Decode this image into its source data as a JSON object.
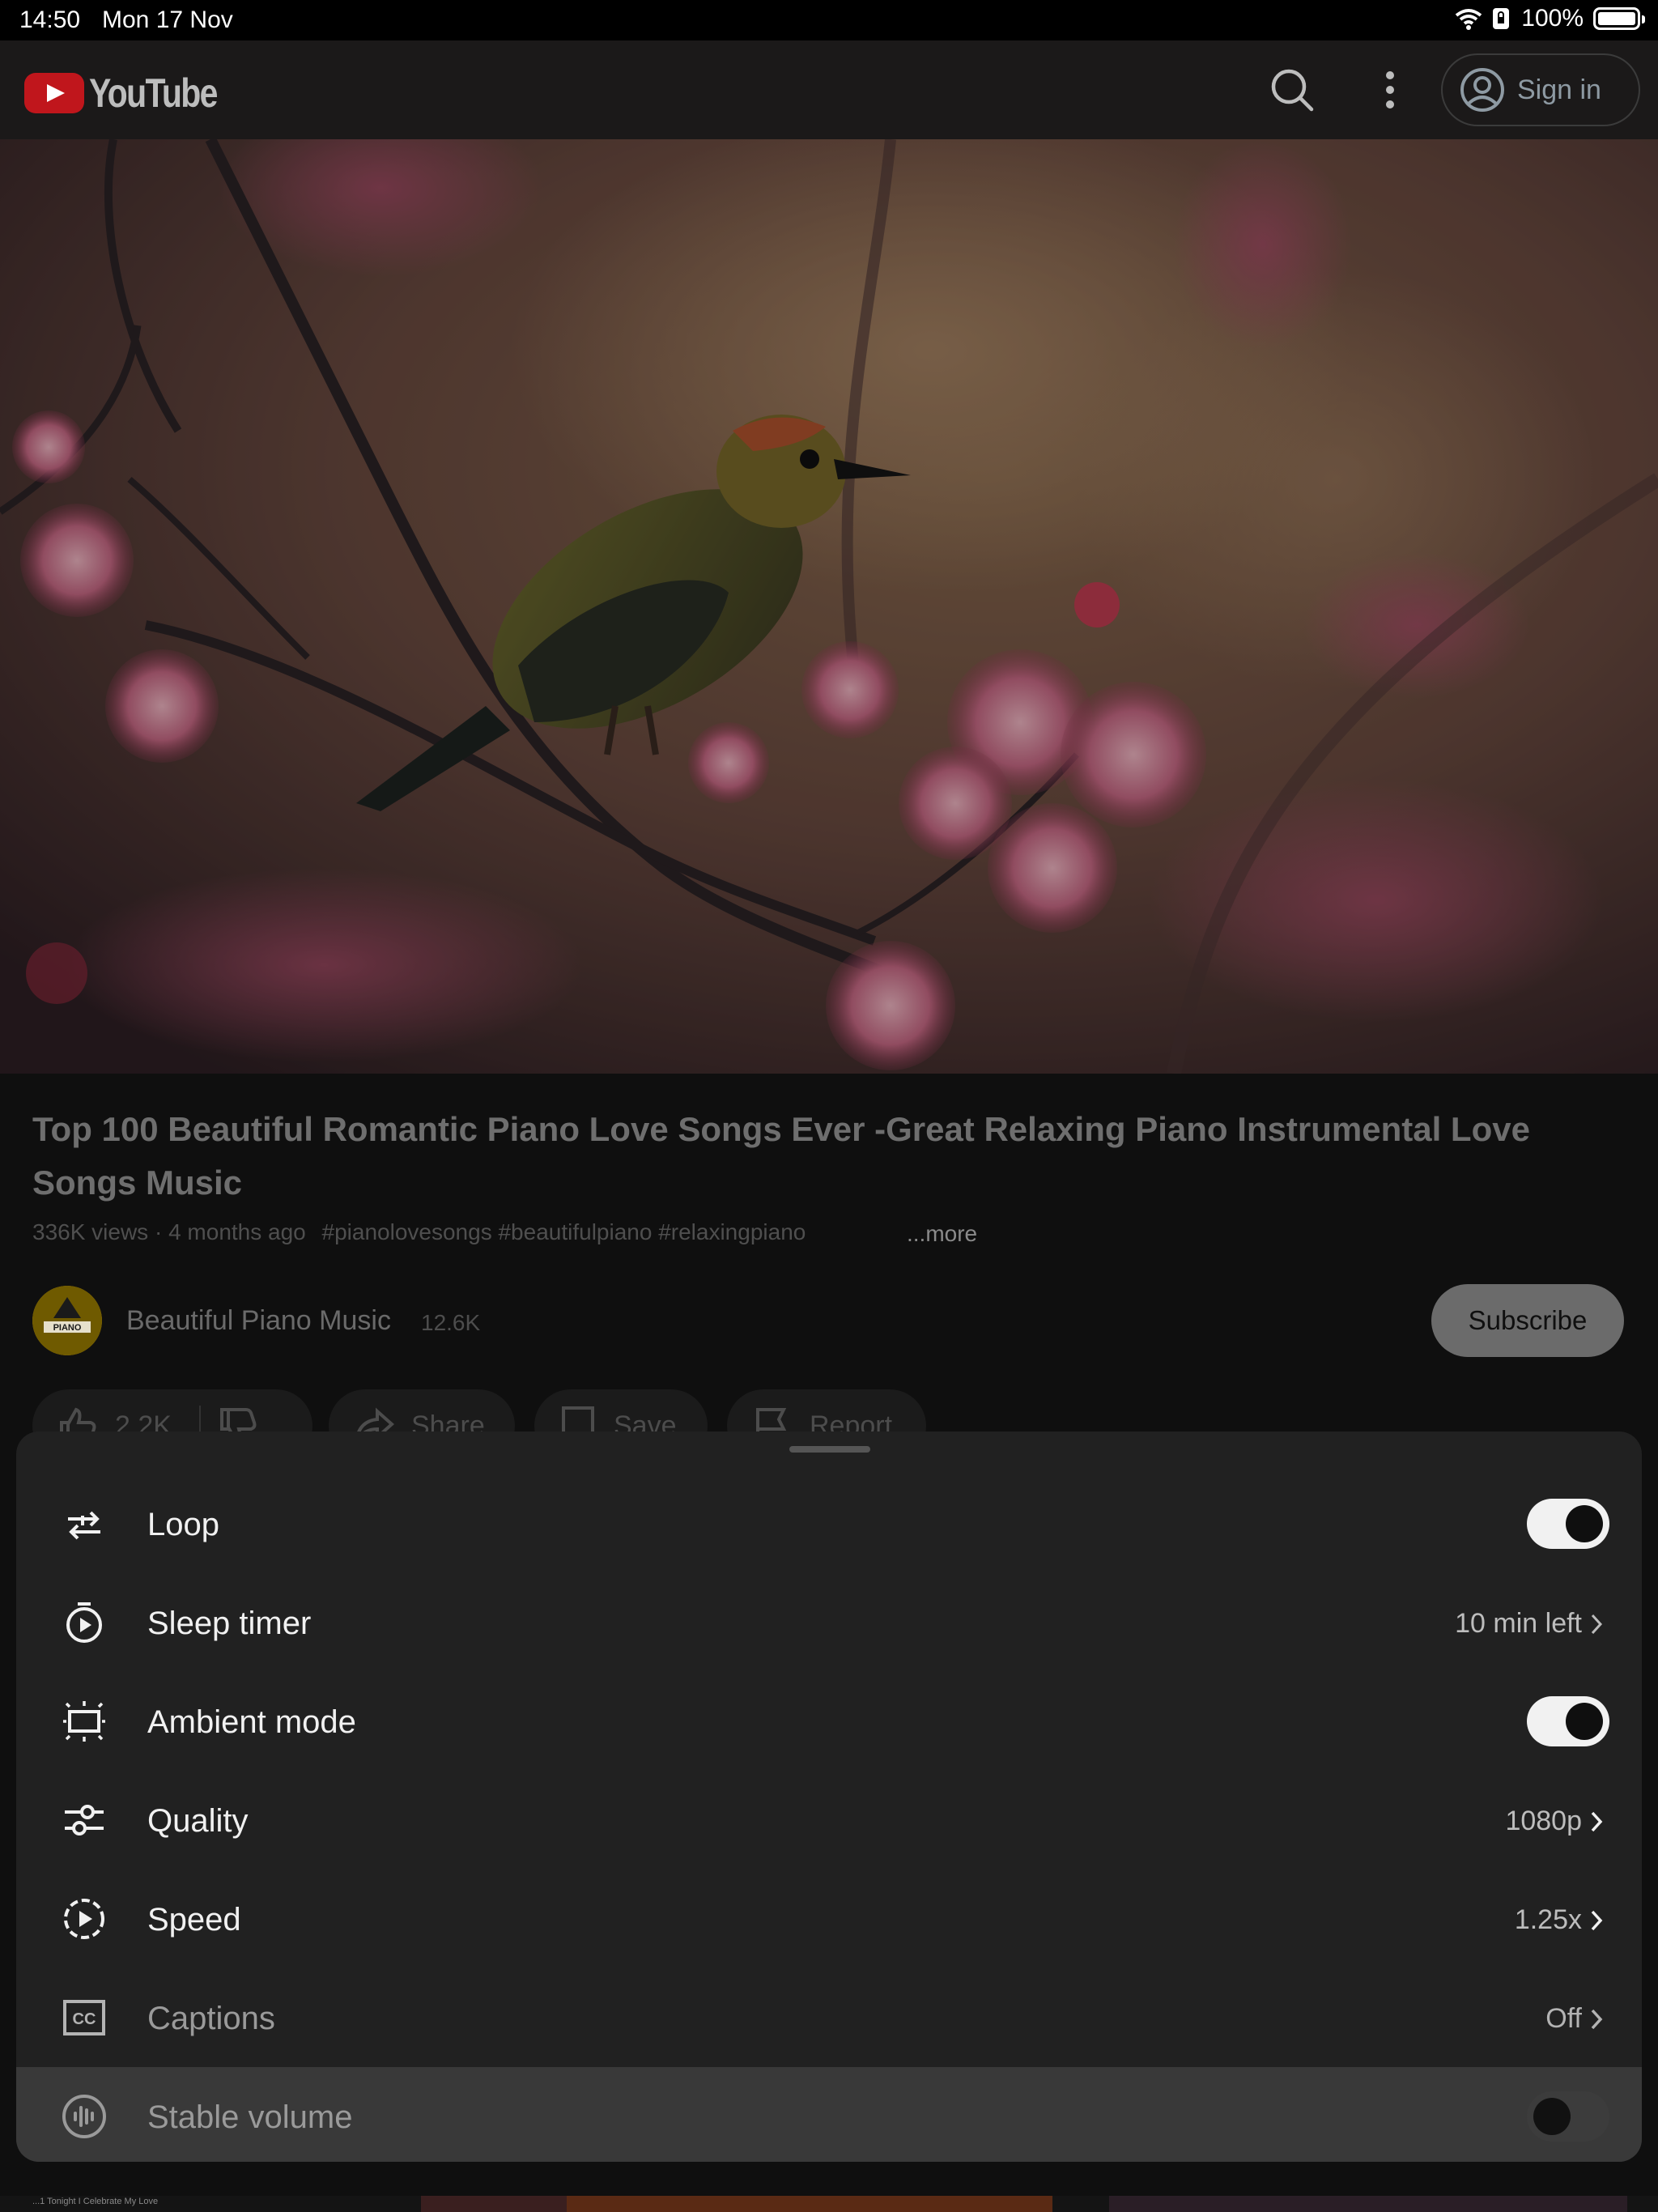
{
  "status_bar": {
    "time": "14:50",
    "date": "Mon 17 Nov",
    "battery": "100%"
  },
  "header": {
    "logo_text": "YouTube",
    "sign_in_label": "Sign in"
  },
  "video": {
    "title": "Top 100 Beautiful Romantic Piano Love Songs Ever -Great Relaxing Piano Instrumental Love Songs Music",
    "views": "336K views",
    "age": "4 months ago",
    "tags": "#pianolovesongs #beautifulpiano #relaxingpiano",
    "more_label": "...more"
  },
  "channel": {
    "avatar_text": "PIANO",
    "name": "Beautiful Piano Music",
    "subscribers": "12.6K",
    "subscribe_label": "Subscribe"
  },
  "actions": {
    "likes": "2.2K",
    "share": "Share",
    "save": "Save",
    "report": "Report"
  },
  "settings_sheet": {
    "items": [
      {
        "label": "Loop",
        "control": "toggle",
        "state": "on"
      },
      {
        "label": "Sleep timer",
        "value": "10 min left"
      },
      {
        "label": "Ambient mode",
        "control": "toggle",
        "state": "on"
      },
      {
        "label": "Quality",
        "value": "1080p"
      },
      {
        "label": "Speed",
        "value": "1.25x"
      },
      {
        "label": "Captions",
        "value": "Off"
      },
      {
        "label": "Stable volume",
        "control": "toggle",
        "state": "off"
      }
    ]
  },
  "bottom_strip": {
    "caption": "...1 Tonight I Celebrate My Love"
  }
}
